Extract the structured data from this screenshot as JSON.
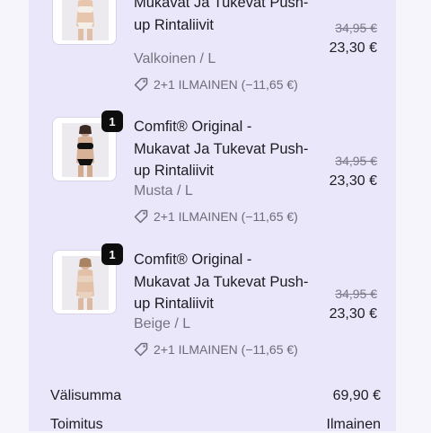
{
  "items": [
    {
      "title_line2": "Mukavat Ja Tukevat Push-",
      "title_line3": "up Rintaliivit",
      "variant": "Valkoinen / L",
      "discount": "2+1 ILMAINEN (−11,65 €)",
      "original_price": "34,95 €",
      "price": "23,30 €",
      "colors": {
        "top": "#f4efe8",
        "bottom": "#f4efe8"
      }
    },
    {
      "quantity": "1",
      "title_line1": "Comfit® Original -",
      "title_line2": "Mukavat Ja Tukevat Push-",
      "title_line3": "up Rintaliivit",
      "variant": "Musta / L",
      "discount": "2+1 ILMAINEN (−11,65 €)",
      "original_price": "34,95 €",
      "price": "23,30 €",
      "colors": {
        "top": "#111111",
        "bottom": "#111111"
      }
    },
    {
      "quantity": "1",
      "title_line1": "Comfit® Original -",
      "title_line2": "Mukavat Ja Tukevat Push-",
      "title_line3": "up Rintaliivit",
      "variant": "Beige / L",
      "discount": "2+1 ILMAINEN (−11,65 €)",
      "original_price": "34,95 €",
      "price": "23,30 €",
      "colors": {
        "top": "#e9d3bf",
        "bottom": "#e9d3bf"
      }
    }
  ],
  "summary": {
    "subtotal_label": "Välisumma",
    "subtotal_value": "69,90 €",
    "shipping_label": "Toimitus",
    "shipping_value": "Ilmainen"
  },
  "icons": {
    "discount": "tag-icon"
  },
  "theme": {
    "panel": "#ebe7fa",
    "background": "#f6f5fb",
    "badge": "#0d0d0d"
  }
}
